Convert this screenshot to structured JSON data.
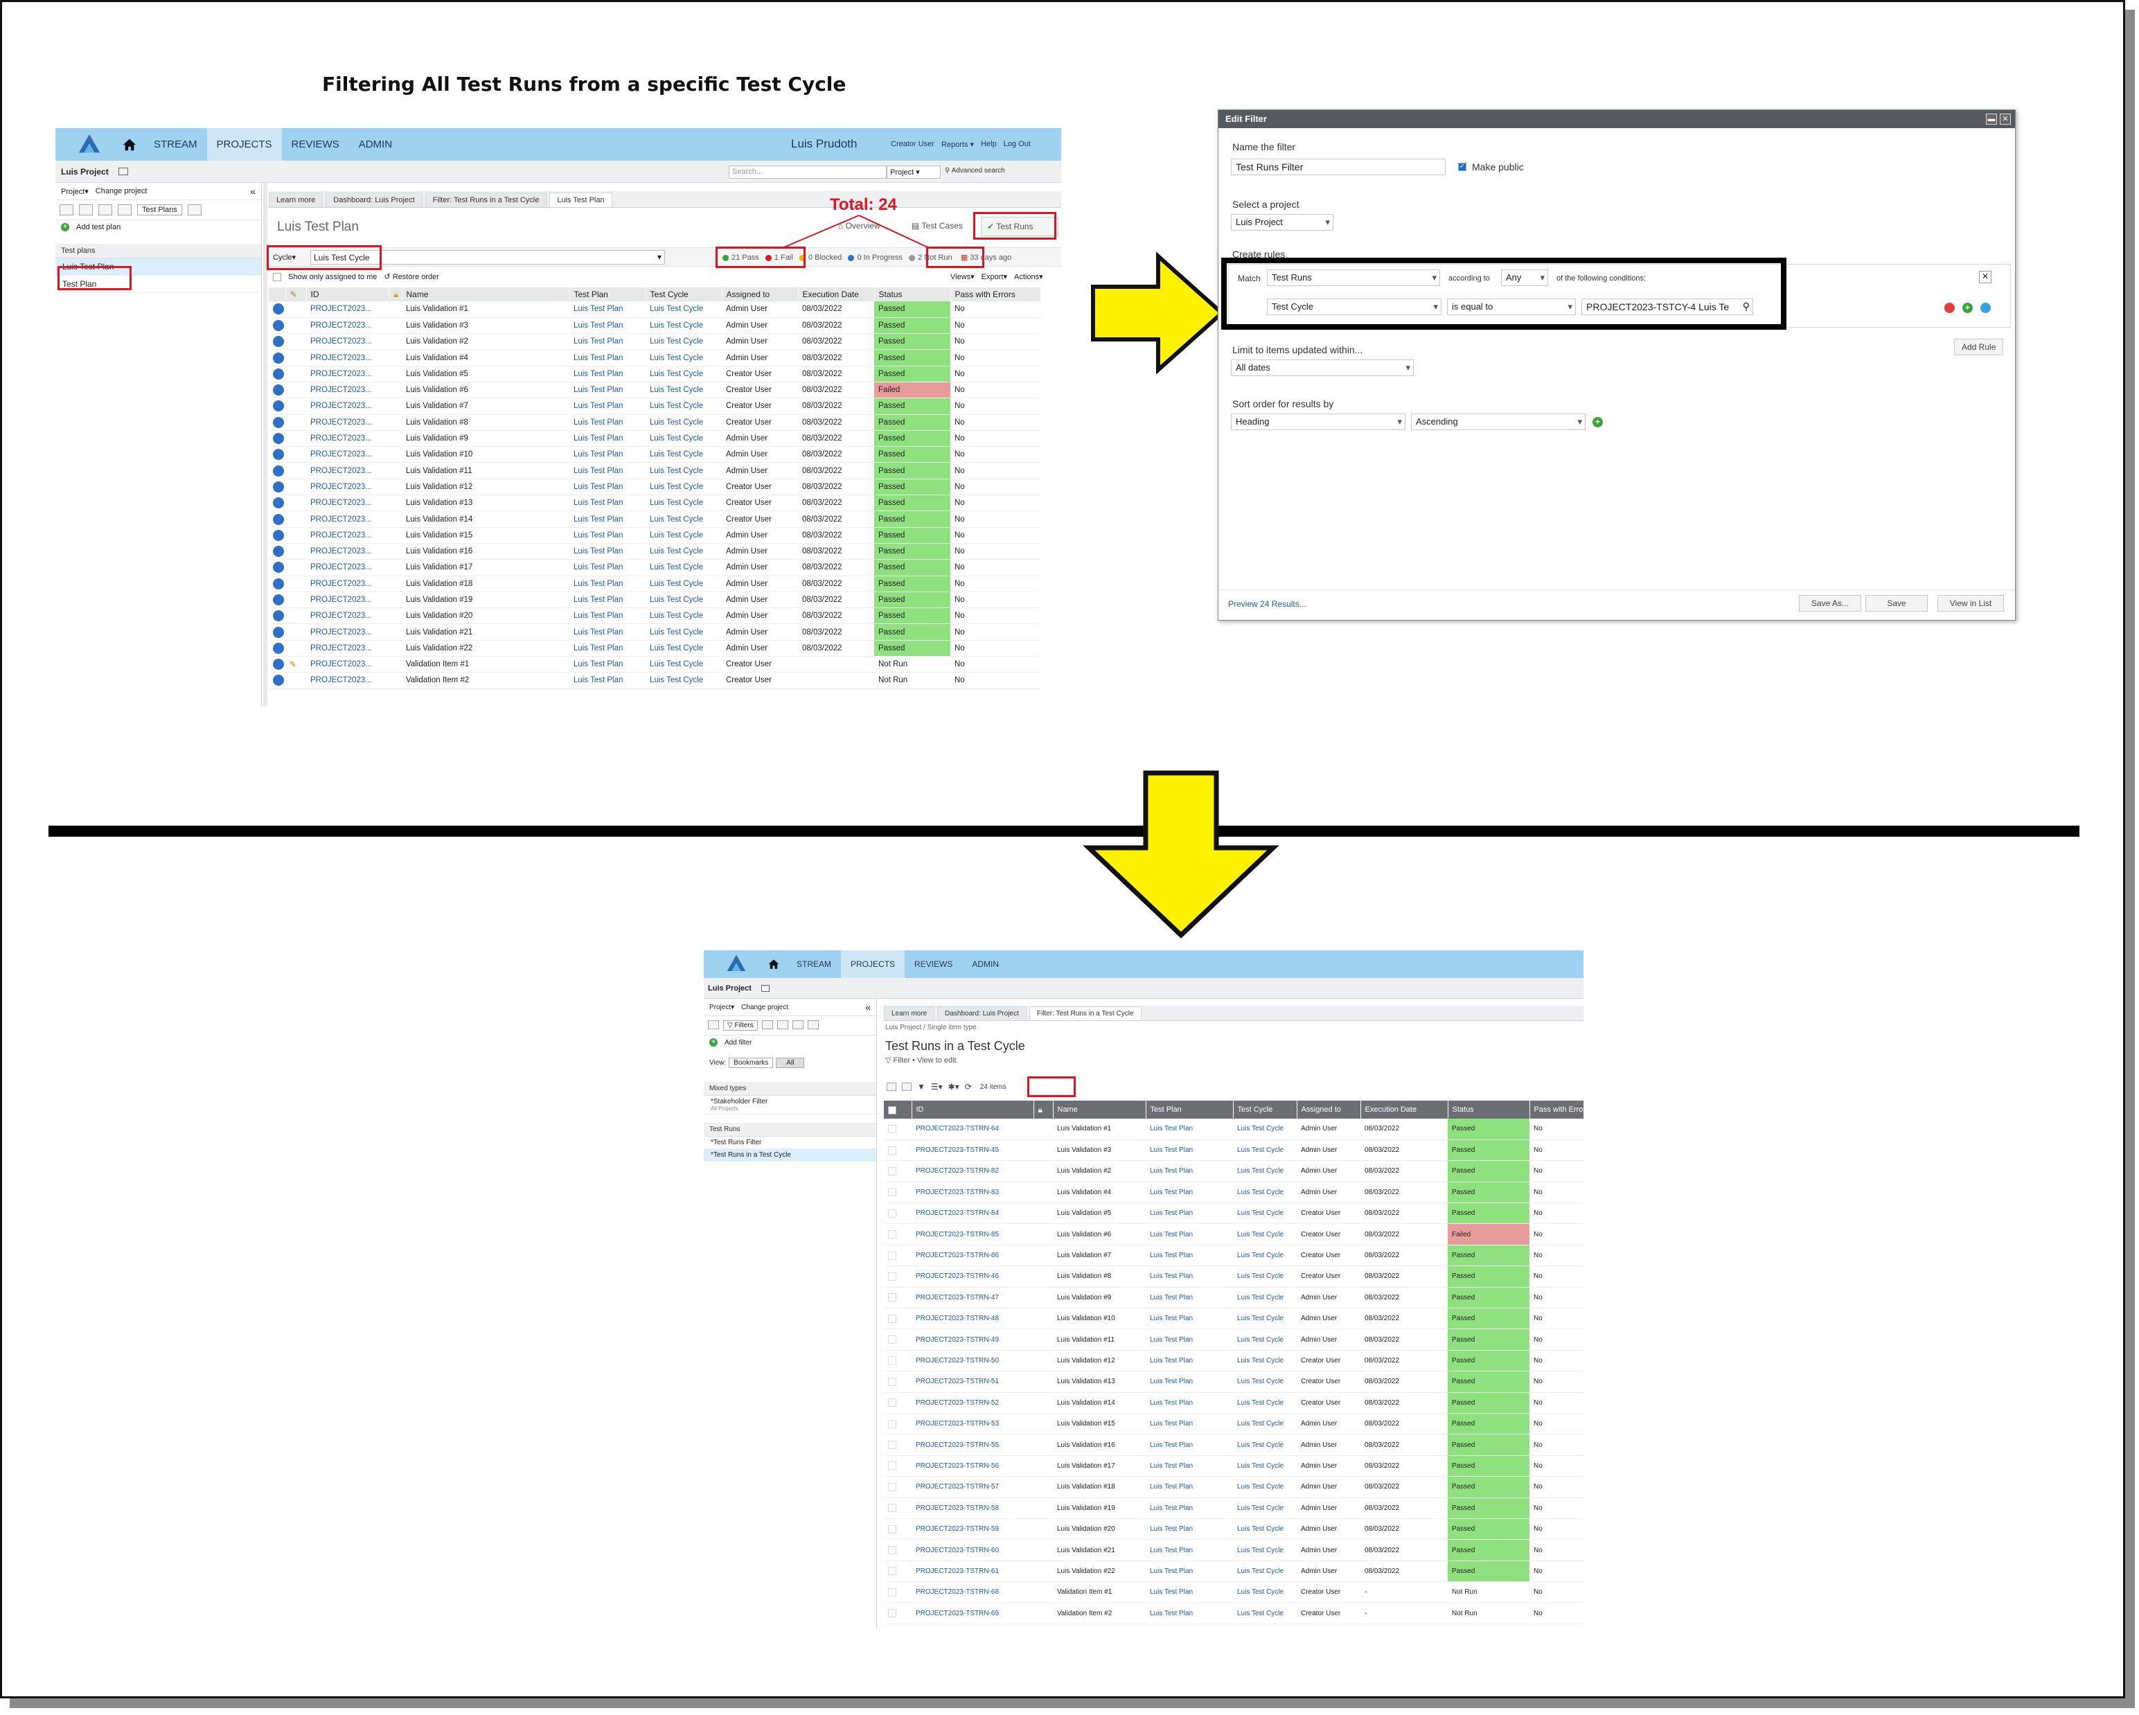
{
  "doc": {
    "title": "Filtering All Test Runs from a specific Test Cycle"
  },
  "app1": {
    "nav": [
      "STREAM",
      "PROJECTS",
      "REVIEWS",
      "ADMIN"
    ],
    "user": "Luis Prudoth",
    "toplinks": [
      "Creator User",
      "Reports ▾",
      "Help",
      "Log Out"
    ],
    "project": "Luis Project",
    "search_placeholder": "Search...",
    "search_scope": "Project",
    "advanced_search": "Advanced search",
    "project_menu": "Project▾",
    "change_project": "Change project",
    "testplans_tab": "Test Plans",
    "add_test_plan": "Add test plan",
    "sidebar_section": "Test plans",
    "sidebar_items": [
      "Luis Test Plan",
      "Test Plan"
    ],
    "tabs": [
      "Learn more",
      "Dashboard: Luis Project",
      "Filter: Test Runs in a Test Cycle",
      "Luis Test Plan"
    ],
    "page_title": "Luis Test Plan",
    "total": "Total: 24",
    "views": [
      "Overview",
      "Test Cases",
      "Test Runs"
    ],
    "cycle_label": "Cycle▾",
    "cycle_value": "Luis Test Cycle",
    "stats": {
      "pass": "21 Pass",
      "fail": "1 Fail",
      "blocked": "0 Blocked",
      "inprogress": "0 In Progress",
      "notrun": "2 Not Run",
      "ago": "33 days ago"
    },
    "show_only": "Show only assigned to me",
    "restore_order": "Restore order",
    "actions": [
      "Views▾",
      "Export▾",
      "Actions▾"
    ],
    "columns": [
      "ID",
      "Name",
      "Test Plan",
      "Test Cycle",
      "Assigned to",
      "Execution Date",
      "Status",
      "Pass with Errors"
    ],
    "rows": [
      [
        "PROJECT2023...",
        "Luis Validation #1",
        "Luis Test Plan",
        "Luis Test Cycle",
        "Admin User",
        "08/03/2022",
        "Passed",
        "No"
      ],
      [
        "PROJECT2023...",
        "Luis Validation #3",
        "Luis Test Plan",
        "Luis Test Cycle",
        "Admin User",
        "08/03/2022",
        "Passed",
        "No"
      ],
      [
        "PROJECT2023...",
        "Luis Validation #2",
        "Luis Test Plan",
        "Luis Test Cycle",
        "Admin User",
        "08/03/2022",
        "Passed",
        "No"
      ],
      [
        "PROJECT2023...",
        "Luis Validation #4",
        "Luis Test Plan",
        "Luis Test Cycle",
        "Admin User",
        "08/03/2022",
        "Passed",
        "No"
      ],
      [
        "PROJECT2023...",
        "Luis Validation #5",
        "Luis Test Plan",
        "Luis Test Cycle",
        "Creator User",
        "08/03/2022",
        "Passed",
        "No"
      ],
      [
        "PROJECT2023...",
        "Luis Validation #6",
        "Luis Test Plan",
        "Luis Test Cycle",
        "Creator User",
        "08/03/2022",
        "Failed",
        "No"
      ],
      [
        "PROJECT2023...",
        "Luis Validation #7",
        "Luis Test Plan",
        "Luis Test Cycle",
        "Creator User",
        "08/03/2022",
        "Passed",
        "No"
      ],
      [
        "PROJECT2023...",
        "Luis Validation #8",
        "Luis Test Plan",
        "Luis Test Cycle",
        "Creator User",
        "08/03/2022",
        "Passed",
        "No"
      ],
      [
        "PROJECT2023...",
        "Luis Validation #9",
        "Luis Test Plan",
        "Luis Test Cycle",
        "Admin User",
        "08/03/2022",
        "Passed",
        "No"
      ],
      [
        "PROJECT2023...",
        "Luis Validation #10",
        "Luis Test Plan",
        "Luis Test Cycle",
        "Admin User",
        "08/03/2022",
        "Passed",
        "No"
      ],
      [
        "PROJECT2023...",
        "Luis Validation #11",
        "Luis Test Plan",
        "Luis Test Cycle",
        "Admin User",
        "08/03/2022",
        "Passed",
        "No"
      ],
      [
        "PROJECT2023...",
        "Luis Validation #12",
        "Luis Test Plan",
        "Luis Test Cycle",
        "Creator User",
        "08/03/2022",
        "Passed",
        "No"
      ],
      [
        "PROJECT2023...",
        "Luis Validation #13",
        "Luis Test Plan",
        "Luis Test Cycle",
        "Creator User",
        "08/03/2022",
        "Passed",
        "No"
      ],
      [
        "PROJECT2023...",
        "Luis Validation #14",
        "Luis Test Plan",
        "Luis Test Cycle",
        "Creator User",
        "08/03/2022",
        "Passed",
        "No"
      ],
      [
        "PROJECT2023...",
        "Luis Validation #15",
        "Luis Test Plan",
        "Luis Test Cycle",
        "Admin User",
        "08/03/2022",
        "Passed",
        "No"
      ],
      [
        "PROJECT2023...",
        "Luis Validation #16",
        "Luis Test Plan",
        "Luis Test Cycle",
        "Admin User",
        "08/03/2022",
        "Passed",
        "No"
      ],
      [
        "PROJECT2023...",
        "Luis Validation #17",
        "Luis Test Plan",
        "Luis Test Cycle",
        "Admin User",
        "08/03/2022",
        "Passed",
        "No"
      ],
      [
        "PROJECT2023...",
        "Luis Validation #18",
        "Luis Test Plan",
        "Luis Test Cycle",
        "Admin User",
        "08/03/2022",
        "Passed",
        "No"
      ],
      [
        "PROJECT2023...",
        "Luis Validation #19",
        "Luis Test Plan",
        "Luis Test Cycle",
        "Admin User",
        "08/03/2022",
        "Passed",
        "No"
      ],
      [
        "PROJECT2023...",
        "Luis Validation #20",
        "Luis Test Plan",
        "Luis Test Cycle",
        "Admin User",
        "08/03/2022",
        "Passed",
        "No"
      ],
      [
        "PROJECT2023...",
        "Luis Validation #21",
        "Luis Test Plan",
        "Luis Test Cycle",
        "Admin User",
        "08/03/2022",
        "Passed",
        "No"
      ],
      [
        "PROJECT2023...",
        "Luis Validation #22",
        "Luis Test Plan",
        "Luis Test Cycle",
        "Admin User",
        "08/03/2022",
        "Passed",
        "No"
      ],
      [
        "PROJECT2023...",
        "Validation Item #1",
        "Luis Test Plan",
        "Luis Test Cycle",
        "Creator User",
        "",
        "Not Run",
        "No"
      ],
      [
        "PROJECT2023...",
        "Validation Item #2",
        "Luis Test Plan",
        "Luis Test Cycle",
        "Creator User",
        "",
        "Not Run",
        "No"
      ]
    ]
  },
  "dialog": {
    "title": "Edit Filter",
    "name_label": "Name the filter",
    "name_value": "Test Runs Filter",
    "make_public": "Make public",
    "project_label": "Select a project",
    "project_value": "Luis Project",
    "rules_label": "Create rules",
    "match": "Match",
    "match_value": "Test Runs",
    "according_to": "according to",
    "any": "Any",
    "following": "of the following conditions:",
    "field": "Test Cycle",
    "operator": "is equal to",
    "value": "PROJECT2023-TSTCY-4 Luis Te",
    "add_rule": "Add Rule",
    "limit_label": "Limit to items updated within...",
    "limit_value": "All dates",
    "sort_label": "Sort order for results by",
    "sort_field": "Heading",
    "sort_dir": "Ascending",
    "preview": "Preview 24 Results...",
    "buttons": [
      "Save As...",
      "Save",
      "View in List"
    ]
  },
  "app2": {
    "nav": [
      "STREAM",
      "PROJECTS",
      "REVIEWS",
      "ADMIN"
    ],
    "project": "Luis Project",
    "project_menu": "Project▾",
    "change_project": "Change project",
    "filters_tab": "Filters",
    "add_filter": "Add filter",
    "view_label": "View:",
    "view_options": [
      "Bookmarks",
      "All"
    ],
    "sec1": "Mixed types",
    "sec1_item": "*Stakeholder Filter",
    "sec1_sub": "All Projects",
    "sec2": "Test Runs",
    "sec2_items": [
      "*Test Runs Filter",
      "*Test Runs in a Test Cycle"
    ],
    "tabs": [
      "Learn more",
      "Dashboard: Luis Project",
      "Filter: Test Runs in a Test Cycle"
    ],
    "breadcrumb": "Luis Project / Single item type",
    "page_title": "Test Runs in a Test Cycle",
    "filter_links": [
      "Filter",
      "View to edit"
    ],
    "items_count": "24 items",
    "columns": [
      "ID",
      "Name",
      "Test Plan",
      "Test Cycle",
      "Assigned to",
      "Execution Date",
      "Status",
      "Pass with Errors"
    ],
    "rows": [
      [
        "PROJECT2023-TSTRN-64",
        "Luis Validation #1",
        "Luis Test Plan",
        "Luis Test Cycle",
        "Admin User",
        "08/03/2022",
        "Passed",
        "No"
      ],
      [
        "PROJECT2023-TSTRN-45",
        "Luis Validation #3",
        "Luis Test Plan",
        "Luis Test Cycle",
        "Admin User",
        "08/03/2022",
        "Passed",
        "No"
      ],
      [
        "PROJECT2023-TSTRN-82",
        "Luis Validation #2",
        "Luis Test Plan",
        "Luis Test Cycle",
        "Admin User",
        "08/03/2022",
        "Passed",
        "No"
      ],
      [
        "PROJECT2023-TSTRN-83",
        "Luis Validation #4",
        "Luis Test Plan",
        "Luis Test Cycle",
        "Admin User",
        "08/03/2022",
        "Passed",
        "No"
      ],
      [
        "PROJECT2023-TSTRN-84",
        "Luis Validation #5",
        "Luis Test Plan",
        "Luis Test Cycle",
        "Creator User",
        "08/03/2022",
        "Passed",
        "No"
      ],
      [
        "PROJECT2023-TSTRN-85",
        "Luis Validation #6",
        "Luis Test Plan",
        "Luis Test Cycle",
        "Creator User",
        "08/03/2022",
        "Failed",
        "No"
      ],
      [
        "PROJECT2023-TSTRN-86",
        "Luis Validation #7",
        "Luis Test Plan",
        "Luis Test Cycle",
        "Creator User",
        "08/03/2022",
        "Passed",
        "No"
      ],
      [
        "PROJECT2023-TSTRN-46",
        "Luis Validation #8",
        "Luis Test Plan",
        "Luis Test Cycle",
        "Creator User",
        "08/03/2022",
        "Passed",
        "No"
      ],
      [
        "PROJECT2023-TSTRN-47",
        "Luis Validation #9",
        "Luis Test Plan",
        "Luis Test Cycle",
        "Admin User",
        "08/03/2022",
        "Passed",
        "No"
      ],
      [
        "PROJECT2023-TSTRN-48",
        "Luis Validation #10",
        "Luis Test Plan",
        "Luis Test Cycle",
        "Admin User",
        "08/03/2022",
        "Passed",
        "No"
      ],
      [
        "PROJECT2023-TSTRN-49",
        "Luis Validation #11",
        "Luis Test Plan",
        "Luis Test Cycle",
        "Admin User",
        "08/03/2022",
        "Passed",
        "No"
      ],
      [
        "PROJECT2023-TSTRN-50",
        "Luis Validation #12",
        "Luis Test Plan",
        "Luis Test Cycle",
        "Creator User",
        "08/03/2022",
        "Passed",
        "No"
      ],
      [
        "PROJECT2023-TSTRN-51",
        "Luis Validation #13",
        "Luis Test Plan",
        "Luis Test Cycle",
        "Creator User",
        "08/03/2022",
        "Passed",
        "No"
      ],
      [
        "PROJECT2023-TSTRN-52",
        "Luis Validation #14",
        "Luis Test Plan",
        "Luis Test Cycle",
        "Creator User",
        "08/03/2022",
        "Passed",
        "No"
      ],
      [
        "PROJECT2023-TSTRN-53",
        "Luis Validation #15",
        "Luis Test Plan",
        "Luis Test Cycle",
        "Admin User",
        "08/03/2022",
        "Passed",
        "No"
      ],
      [
        "PROJECT2023-TSTRN-55",
        "Luis Validation #16",
        "Luis Test Plan",
        "Luis Test Cycle",
        "Admin User",
        "08/03/2022",
        "Passed",
        "No"
      ],
      [
        "PROJECT2023-TSTRN-56",
        "Luis Validation #17",
        "Luis Test Plan",
        "Luis Test Cycle",
        "Admin User",
        "08/03/2022",
        "Passed",
        "No"
      ],
      [
        "PROJECT2023-TSTRN-57",
        "Luis Validation #18",
        "Luis Test Plan",
        "Luis Test Cycle",
        "Admin User",
        "08/03/2022",
        "Passed",
        "No"
      ],
      [
        "PROJECT2023-TSTRN-58",
        "Luis Validation #19",
        "Luis Test Plan",
        "Luis Test Cycle",
        "Admin User",
        "08/03/2022",
        "Passed",
        "No"
      ],
      [
        "PROJECT2023-TSTRN-59",
        "Luis Validation #20",
        "Luis Test Plan",
        "Luis Test Cycle",
        "Admin User",
        "08/03/2022",
        "Passed",
        "No"
      ],
      [
        "PROJECT2023-TSTRN-60",
        "Luis Validation #21",
        "Luis Test Plan",
        "Luis Test Cycle",
        "Admin User",
        "08/03/2022",
        "Passed",
        "No"
      ],
      [
        "PROJECT2023-TSTRN-61",
        "Luis Validation #22",
        "Luis Test Plan",
        "Luis Test Cycle",
        "Admin User",
        "08/03/2022",
        "Passed",
        "No"
      ],
      [
        "PROJECT2023-TSTRN-68",
        "Validation Item #1",
        "Luis Test Plan",
        "Luis Test Cycle",
        "Creator User",
        "-",
        "Not Run",
        "No"
      ],
      [
        "PROJECT2023-TSTRN-69",
        "Validation Item #2",
        "Luis Test Plan",
        "Luis Test Cycle",
        "Creator User",
        "-",
        "Not Run",
        "No"
      ]
    ]
  },
  "colors": {
    "nav": "#9fd1f1",
    "pass": "#8fe07e",
    "fail": "#e89b9b",
    "highlight": "#e0141e",
    "arrow": "#fff200"
  }
}
